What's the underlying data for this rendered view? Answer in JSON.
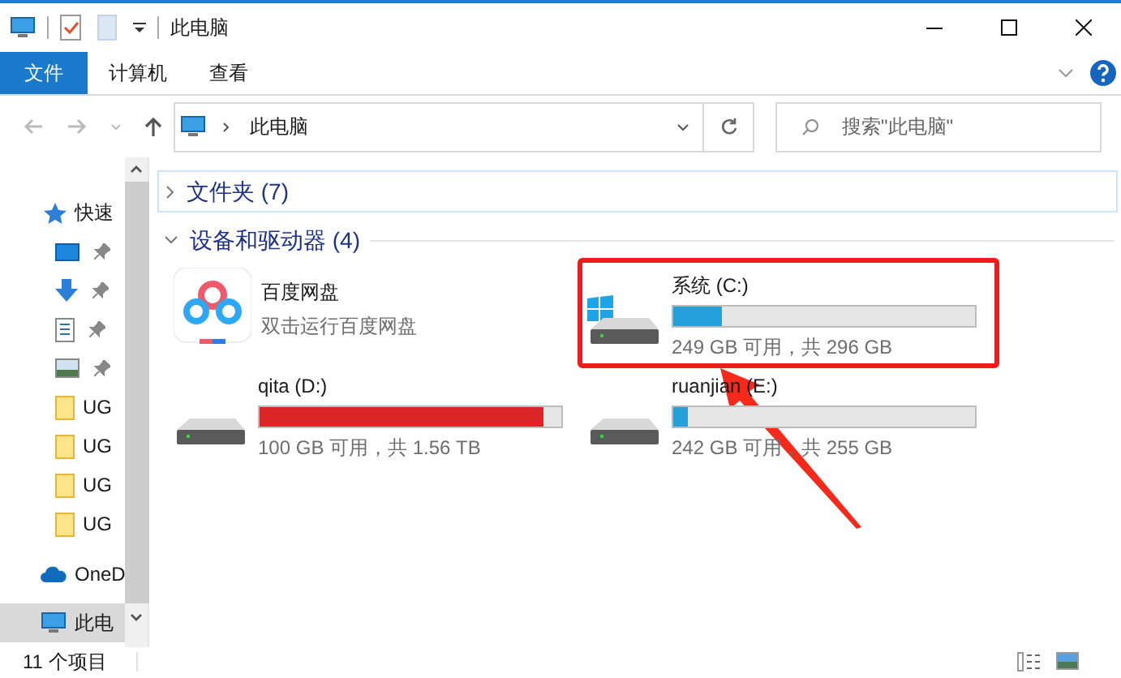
{
  "window": {
    "title": "此电脑"
  },
  "ribbon": {
    "tabs": [
      {
        "label": "文件",
        "selected": true
      },
      {
        "label": "计算机",
        "selected": false
      },
      {
        "label": "查看",
        "selected": false
      }
    ]
  },
  "address": {
    "path": "此电脑"
  },
  "search": {
    "placeholder": "搜索\"此电脑\""
  },
  "sidebar": {
    "items": [
      {
        "kind": "quick",
        "label": "快速"
      },
      {
        "kind": "desktop",
        "pinned": true
      },
      {
        "kind": "download",
        "pinned": true
      },
      {
        "kind": "document",
        "pinned": true
      },
      {
        "kind": "image",
        "pinned": true
      },
      {
        "kind": "folder",
        "label": "UG"
      },
      {
        "kind": "folder",
        "label": "UG"
      },
      {
        "kind": "folder",
        "label": "UG"
      },
      {
        "kind": "folder",
        "label": "UG"
      },
      {
        "kind": "cloud",
        "label": "OneD"
      },
      {
        "kind": "pc",
        "label": "此电",
        "selected": true
      }
    ]
  },
  "groups": [
    {
      "title": "文件夹 (7)",
      "expanded": false
    },
    {
      "title": "设备和驱动器 (4)",
      "expanded": true
    }
  ],
  "devices": [
    {
      "kind": "app",
      "name": "百度网盘",
      "detail": "双击运行百度网盘"
    },
    {
      "kind": "drive",
      "name": "系统 (C:)",
      "system": true,
      "level": 0.16,
      "detail": "249 GB 可用，共 296 GB",
      "highlighted": true
    },
    {
      "kind": "drive",
      "name": "qita (D:)",
      "system": false,
      "level": 0.94,
      "detail": "100 GB 可用，共 1.56 TB"
    },
    {
      "kind": "drive",
      "name": "ruanjian (E:)",
      "system": false,
      "level": 0.05,
      "detail": "242 GB 可用，共 255 GB"
    }
  ],
  "status_bar": {
    "count": "11 个项目"
  }
}
